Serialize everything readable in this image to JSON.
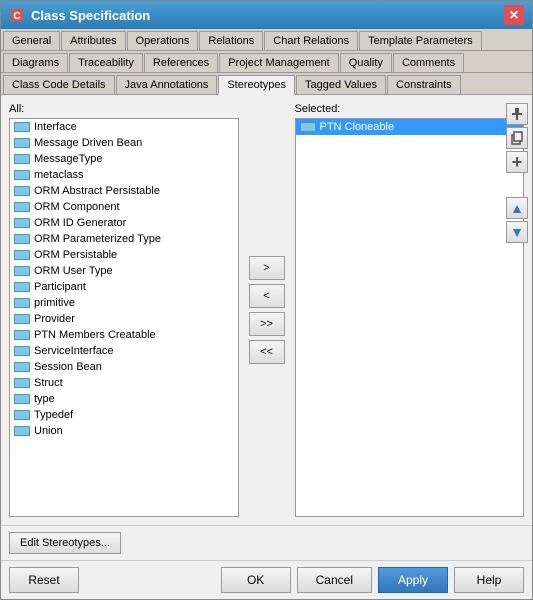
{
  "window": {
    "title": "Class Specification",
    "close_label": "✕"
  },
  "tabs_row1": {
    "tabs": [
      {
        "label": "General",
        "active": false
      },
      {
        "label": "Attributes",
        "active": false
      },
      {
        "label": "Operations",
        "active": false
      },
      {
        "label": "Relations",
        "active": false
      },
      {
        "label": "Chart Relations",
        "active": false
      },
      {
        "label": "Template Parameters",
        "active": false
      }
    ]
  },
  "tabs_row2": {
    "tabs": [
      {
        "label": "Diagrams",
        "active": false
      },
      {
        "label": "Traceability",
        "active": false
      },
      {
        "label": "References",
        "active": false
      },
      {
        "label": "Project Management",
        "active": false
      },
      {
        "label": "Quality",
        "active": false
      },
      {
        "label": "Comments",
        "active": false
      }
    ]
  },
  "tabs_row3": {
    "tabs": [
      {
        "label": "Class Code Details",
        "active": false
      },
      {
        "label": "Java Annotations",
        "active": false
      },
      {
        "label": "Stereotypes",
        "active": true
      },
      {
        "label": "Tagged Values",
        "active": false
      },
      {
        "label": "Constraints",
        "active": false
      }
    ]
  },
  "all_label": "All:",
  "selected_label": "Selected:",
  "all_items": [
    "Interface",
    "Message Driven Bean",
    "MessageType",
    "metaclass",
    "ORM Abstract Persistable",
    "ORM Component",
    "ORM ID Generator",
    "ORM Parameterized Type",
    "ORM Persistable",
    "ORM User Type",
    "Participant",
    "primitive",
    "Provider",
    "PTN Members Creatable",
    "ServiceInterface",
    "Session Bean",
    "Struct",
    "type",
    "Typedef",
    "Union"
  ],
  "selected_items": [
    "PTN Cloneable"
  ],
  "buttons": {
    "move_right": ">",
    "move_left": "<",
    "move_all_right": ">>",
    "move_all_left": "<<"
  },
  "edit_stereotypes_label": "Edit Stereotypes...",
  "footer": {
    "reset": "Reset",
    "ok": "OK",
    "cancel": "Cancel",
    "apply": "Apply",
    "help": "Help"
  }
}
